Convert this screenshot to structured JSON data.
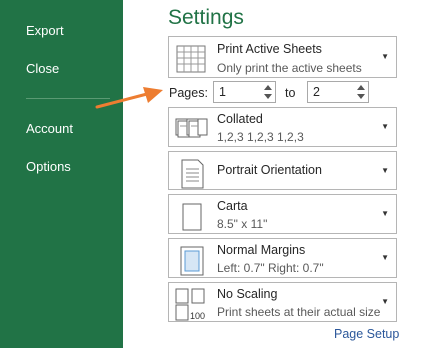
{
  "sidebar": {
    "items": [
      {
        "label": "Export"
      },
      {
        "label": "Close"
      },
      {
        "label": "Account"
      },
      {
        "label": "Options"
      }
    ]
  },
  "settings": {
    "title": "Settings",
    "print_what": {
      "label": "Print Active Sheets",
      "sub": "Only print the active sheets"
    },
    "pages": {
      "label": "Pages:",
      "from": "1",
      "to_label": "to",
      "to": "2"
    },
    "collation": {
      "label": "Collated",
      "sub": "1,2,3    1,2,3    1,2,3"
    },
    "orientation": {
      "label": "Portrait Orientation"
    },
    "paper": {
      "label": "Carta",
      "sub": "8.5\" x 11\""
    },
    "margins": {
      "label": "Normal Margins",
      "sub": "Left: 0.7\"    Right: 0.7\""
    },
    "scaling": {
      "label": "No Scaling",
      "sub": "Print sheets at their actual size"
    },
    "page_setup_link": "Page Setup",
    "scaling_icon_text": "100"
  },
  "colors": {
    "sidebar": "#217346",
    "title": "#217346",
    "link": "#2b579a",
    "arrow": "#ed7d31"
  }
}
